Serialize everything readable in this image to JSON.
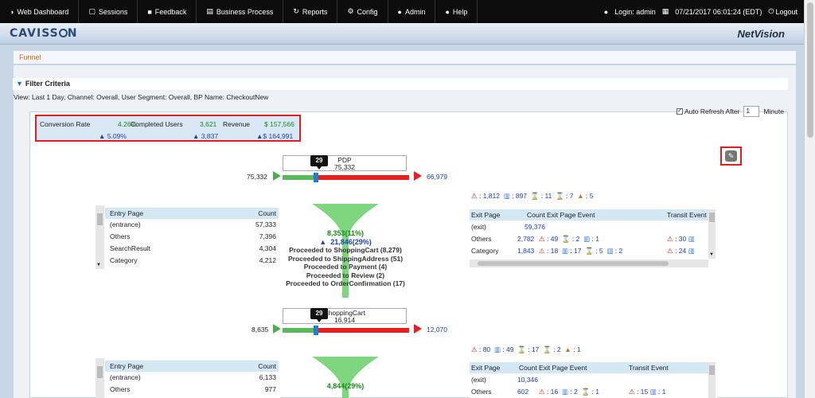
{
  "topbar": {
    "nav": [
      {
        "icon": "dashboard-icon",
        "glyph": "◑",
        "label": "Web Dashboard"
      },
      {
        "icon": "sessions-icon",
        "glyph": "▢",
        "label": "Sessions"
      },
      {
        "icon": "feedback-icon",
        "glyph": "■",
        "label": "Feedback"
      },
      {
        "icon": "business-process-icon",
        "glyph": "▤",
        "label": "Business Process"
      },
      {
        "icon": "reports-icon",
        "glyph": "↻",
        "label": "Reports"
      },
      {
        "icon": "config-icon",
        "glyph": "⚙",
        "label": "Config"
      },
      {
        "icon": "admin-icon",
        "glyph": "●",
        "label": "Admin"
      },
      {
        "icon": "help-icon",
        "glyph": "●",
        "label": "Help"
      }
    ],
    "login": "Login: admin",
    "datetime": "07/21/2017 06:01:24 (EDT)",
    "logout": "Logout"
  },
  "header": {
    "logo": "CAVISSON",
    "brand": "NetVision"
  },
  "breadcrumb": "Funnel",
  "filter": {
    "title": "Filter Criteria",
    "view": "View: Last 1 Day, Channel: Overall, User Segment: Overall, BP Name: CheckoutNew",
    "auto_refresh_label": "Auto Refresh After",
    "auto_refresh_value": "1",
    "minute_label": "Minute"
  },
  "kpis": {
    "conversion_label": "Conversion Rate",
    "conversion_value": "4.26%",
    "conversion_delta": "5.09%",
    "completed_label": "Completed Users",
    "completed_value": "3,621",
    "completed_delta": "3,837",
    "revenue_label": "Revenue",
    "revenue_value": "$ 157,566",
    "revenue_delta": "$ 164,991"
  },
  "stages": [
    {
      "badge": "29",
      "name": "PDP",
      "count": "75,332",
      "in_count": "75,332",
      "out_count": "66,979",
      "entry": {
        "header": [
          "Entry Page",
          "Count"
        ],
        "rows": [
          [
            "(entrance)",
            "57,333"
          ],
          [
            "Others",
            "7,396"
          ],
          [
            "SearchResult",
            "4,304"
          ],
          [
            "Category",
            "4,212"
          ]
        ]
      },
      "funnel": {
        "main": "8,353(11%)",
        "delta": "21,846(29%)",
        "lines": [
          "Proceeded to ShoppingCart (8,279)",
          "Proceeded to ShippingAddress (51)",
          "Proceeded to Payment (4)",
          "Proceeded to Review (2)",
          "Proceeded to OrderConfirmation (17)"
        ]
      },
      "exit_stats": [
        "1,812",
        "897",
        "11",
        "7",
        "5"
      ],
      "exit": {
        "header": [
          "Exit Page",
          "Count",
          "Exit Page Event",
          "Transit Event"
        ],
        "rows": [
          {
            "page": "(exit)",
            "count": "59,376",
            "events": []
          },
          {
            "page": "Others",
            "count": "2,782",
            "events": [
              "49",
              "2",
              "1"
            ],
            "transit": [
              "30",
              ""
            ]
          },
          {
            "page": "Category",
            "count": "1,843",
            "events": [
              "18",
              "17",
              "5",
              "2"
            ],
            "transit": [
              "24",
              ""
            ]
          }
        ]
      }
    },
    {
      "badge": "29",
      "name": "ShoppingCart",
      "count": "16,914",
      "in_count": "8,635",
      "out_count": "12,070",
      "entry": {
        "header": [
          "Entry Page",
          "Count"
        ],
        "rows": [
          [
            "(entrance)",
            "6,133"
          ],
          [
            "Others",
            "977"
          ]
        ]
      },
      "funnel": {
        "main": "4,844(29%)"
      },
      "exit_stats": [
        "80",
        "49",
        "17",
        "2",
        "1"
      ],
      "exit": {
        "header": [
          "Exit Page",
          "Count",
          "Exit Page Event",
          "Transit Event"
        ],
        "rows": [
          {
            "page": "(exit)",
            "count": "10,346",
            "events": []
          },
          {
            "page": "Others",
            "count": "602",
            "events": [
              "16",
              "2",
              "1"
            ],
            "transit": [
              "15",
              "1"
            ]
          }
        ]
      }
    }
  ]
}
